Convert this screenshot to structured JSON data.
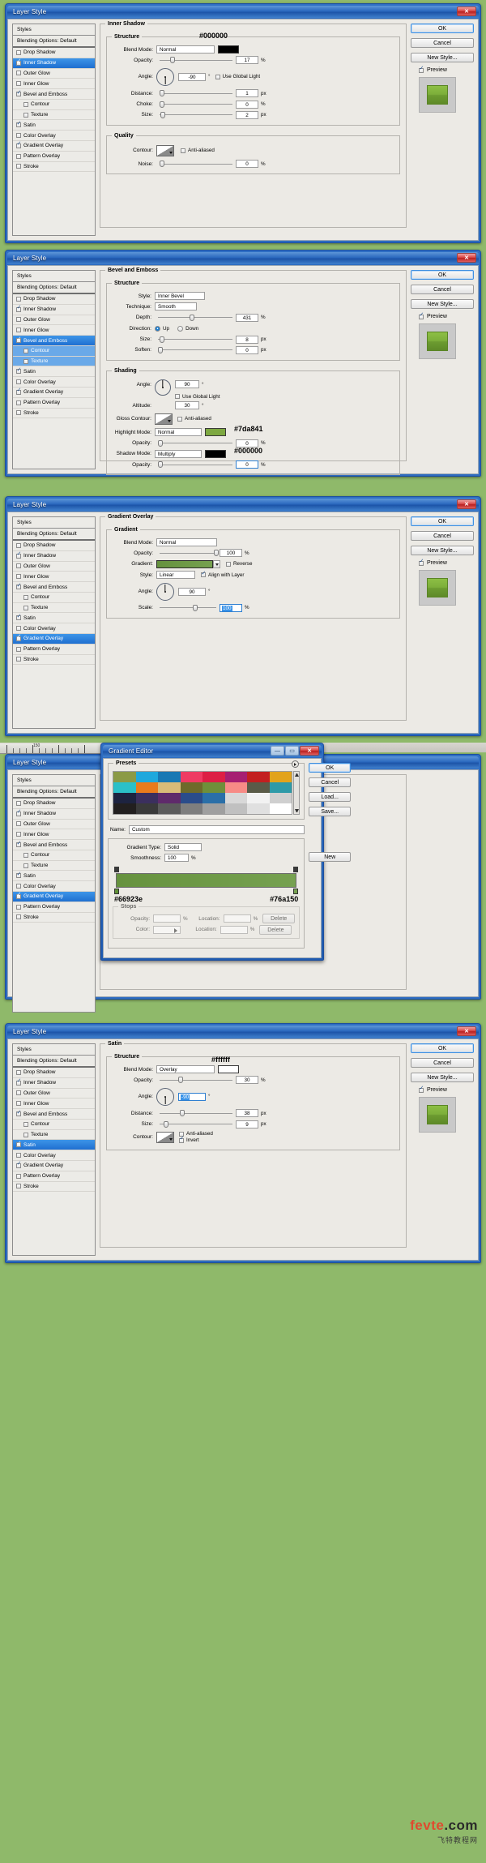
{
  "app": {
    "dialog_title": "Layer Style",
    "gradient_editor_title": "Gradient Editor"
  },
  "buttons": {
    "ok": "OK",
    "cancel": "Cancel",
    "new_style": "New Style...",
    "load": "Load...",
    "save": "Save...",
    "new": "New",
    "delete": "Delete",
    "preview": "Preview"
  },
  "styles_list": {
    "header": "Styles",
    "blending_options": "Blending Options: Default",
    "items": [
      {
        "label": "Drop Shadow",
        "checked": false,
        "indent": false
      },
      {
        "label": "Inner Shadow",
        "checked": true,
        "indent": false
      },
      {
        "label": "Outer Glow",
        "checked": false,
        "indent": false
      },
      {
        "label": "Inner Glow",
        "checked": false,
        "indent": false
      },
      {
        "label": "Bevel and Emboss",
        "checked": true,
        "indent": false
      },
      {
        "label": "Contour",
        "checked": false,
        "indent": true
      },
      {
        "label": "Texture",
        "checked": false,
        "indent": true
      },
      {
        "label": "Satin",
        "checked": true,
        "indent": false
      },
      {
        "label": "Color Overlay",
        "checked": false,
        "indent": false
      },
      {
        "label": "Gradient Overlay",
        "checked": true,
        "indent": false
      },
      {
        "label": "Pattern Overlay",
        "checked": false,
        "indent": false
      },
      {
        "label": "Stroke",
        "checked": false,
        "indent": false
      }
    ]
  },
  "panel1": {
    "selected_item": "Inner Shadow",
    "group_title": "Inner Shadow",
    "structure_title": "Structure",
    "quality_title": "Quality",
    "labels": {
      "blend_mode": "Blend Mode:",
      "opacity": "Opacity:",
      "angle": "Angle:",
      "distance": "Distance:",
      "choke": "Choke:",
      "size": "Size:",
      "contour": "Contour:",
      "noise": "Noise:",
      "use_global_light": "Use Global Light",
      "anti_aliased": "Anti-aliased"
    },
    "values": {
      "blend_mode": "Normal",
      "color_hex": "#000000",
      "opacity": "17",
      "angle": "-90",
      "distance": "1",
      "choke": "0",
      "size": "2",
      "noise": "0",
      "use_global_light": false,
      "anti_aliased": false
    },
    "units": {
      "pct": "%",
      "deg": "°",
      "px": "px"
    },
    "annotation_hex": "#000000"
  },
  "panel2": {
    "selected_item": "Bevel and Emboss",
    "group_title": "Bevel and Emboss",
    "structure_title": "Structure",
    "shading_title": "Shading",
    "labels": {
      "style": "Style:",
      "technique": "Technique:",
      "depth": "Depth:",
      "direction": "Direction:",
      "up": "Up",
      "down": "Down",
      "size": "Size:",
      "soften": "Soften:",
      "angle": "Angle:",
      "use_global_light": "Use Global Light",
      "altitude": "Altitude:",
      "gloss_contour": "Gloss Contour:",
      "anti_aliased": "Anti-aliased",
      "highlight_mode": "Highlight Mode:",
      "opacity": "Opacity:",
      "shadow_mode": "Shadow Mode:"
    },
    "values": {
      "style": "Inner Bevel",
      "technique": "Smooth",
      "depth": "431",
      "direction": "Up",
      "size": "8",
      "soften": "0",
      "angle": "90",
      "altitude": "30",
      "anti_aliased": false,
      "use_global_light": false,
      "highlight_mode": "Normal",
      "highlight_color_hex": "#7da841",
      "highlight_opacity": "0",
      "shadow_mode": "Multiply",
      "shadow_color_hex": "#000000",
      "shadow_opacity": "0"
    },
    "annotation_highlight_hex": "#7da841",
    "annotation_shadow_hex": "#000000"
  },
  "panel3": {
    "selected_item": "Gradient Overlay",
    "group_title": "Gradient Overlay",
    "gradient_title": "Gradient",
    "labels": {
      "blend_mode": "Blend Mode:",
      "opacity": "Opacity:",
      "gradient": "Gradient:",
      "reverse": "Reverse",
      "style": "Style:",
      "align_with_layer": "Align with Layer",
      "angle": "Angle:",
      "scale": "Scale:"
    },
    "values": {
      "blend_mode": "Normal",
      "opacity": "100",
      "reverse": false,
      "style": "Linear",
      "align_with_layer": true,
      "angle": "90",
      "scale": "100",
      "gradient_from": "#66923e",
      "gradient_to": "#76a150"
    }
  },
  "gradient_editor": {
    "title": "Gradient Editor",
    "presets_title": "Presets",
    "name_label": "Name:",
    "name_value": "Custom",
    "gradient_type_label": "Gradient Type:",
    "gradient_type_value": "Solid",
    "smoothness_label": "Smoothness:",
    "smoothness_value": "100",
    "smoothness_unit": "%",
    "stops_title": "Stops",
    "opacity_label": "Opacity:",
    "opacity_value": "",
    "opacity_unit": "%",
    "location_label": "Location:",
    "location_value": "",
    "location_unit": "%",
    "color_label": "Color:",
    "delete_label": "Delete",
    "stop_left_hex": "#66923e",
    "stop_right_hex": "#76a150",
    "preset_colors": [
      "#8b9a46",
      "#1fa8dd",
      "#1878b4",
      "#ef3b63",
      "#dd1f45",
      "#a61f72",
      "#c31f20",
      "#e2a31c",
      "#2bc0c8",
      "#ea7b1c",
      "#d9bb78",
      "#6e6a2a",
      "#6f8f3a",
      "#f78b86",
      "#5a5b48",
      "#2e9aa8",
      "#1d2340",
      "#3b2f5e",
      "#5f2a6b",
      "#2a4c8a",
      "#2a6fa8",
      "#d8d8d8",
      "#f2f2f2",
      "#cfcfcf",
      "#221f1f",
      "#3a3a3a",
      "#5c5c5c",
      "#7e7e7e",
      "#9f9f9f",
      "#c0c0c0",
      "#e0e0e0",
      "#ffffff"
    ]
  },
  "panel5": {
    "selected_item": "Satin",
    "group_title": "Satin",
    "structure_title": "Structure",
    "labels": {
      "blend_mode": "Blend Mode:",
      "opacity": "Opacity:",
      "angle": "Angle:",
      "distance": "Distance:",
      "size": "Size:",
      "contour": "Contour:",
      "anti_aliased": "Anti-aliased",
      "invert": "Invert"
    },
    "values": {
      "blend_mode": "Overlay",
      "color_hex": "#ffffff",
      "opacity": "30",
      "angle": "-90",
      "distance": "38",
      "size": "9",
      "anti_aliased": false,
      "invert": true
    },
    "annotation_hex": "#ffffff"
  },
  "watermark": {
    "brand": "fevte",
    "domain": ".com",
    "subtitle": "飞特教程网"
  },
  "ruler": {
    "mark": "150"
  }
}
